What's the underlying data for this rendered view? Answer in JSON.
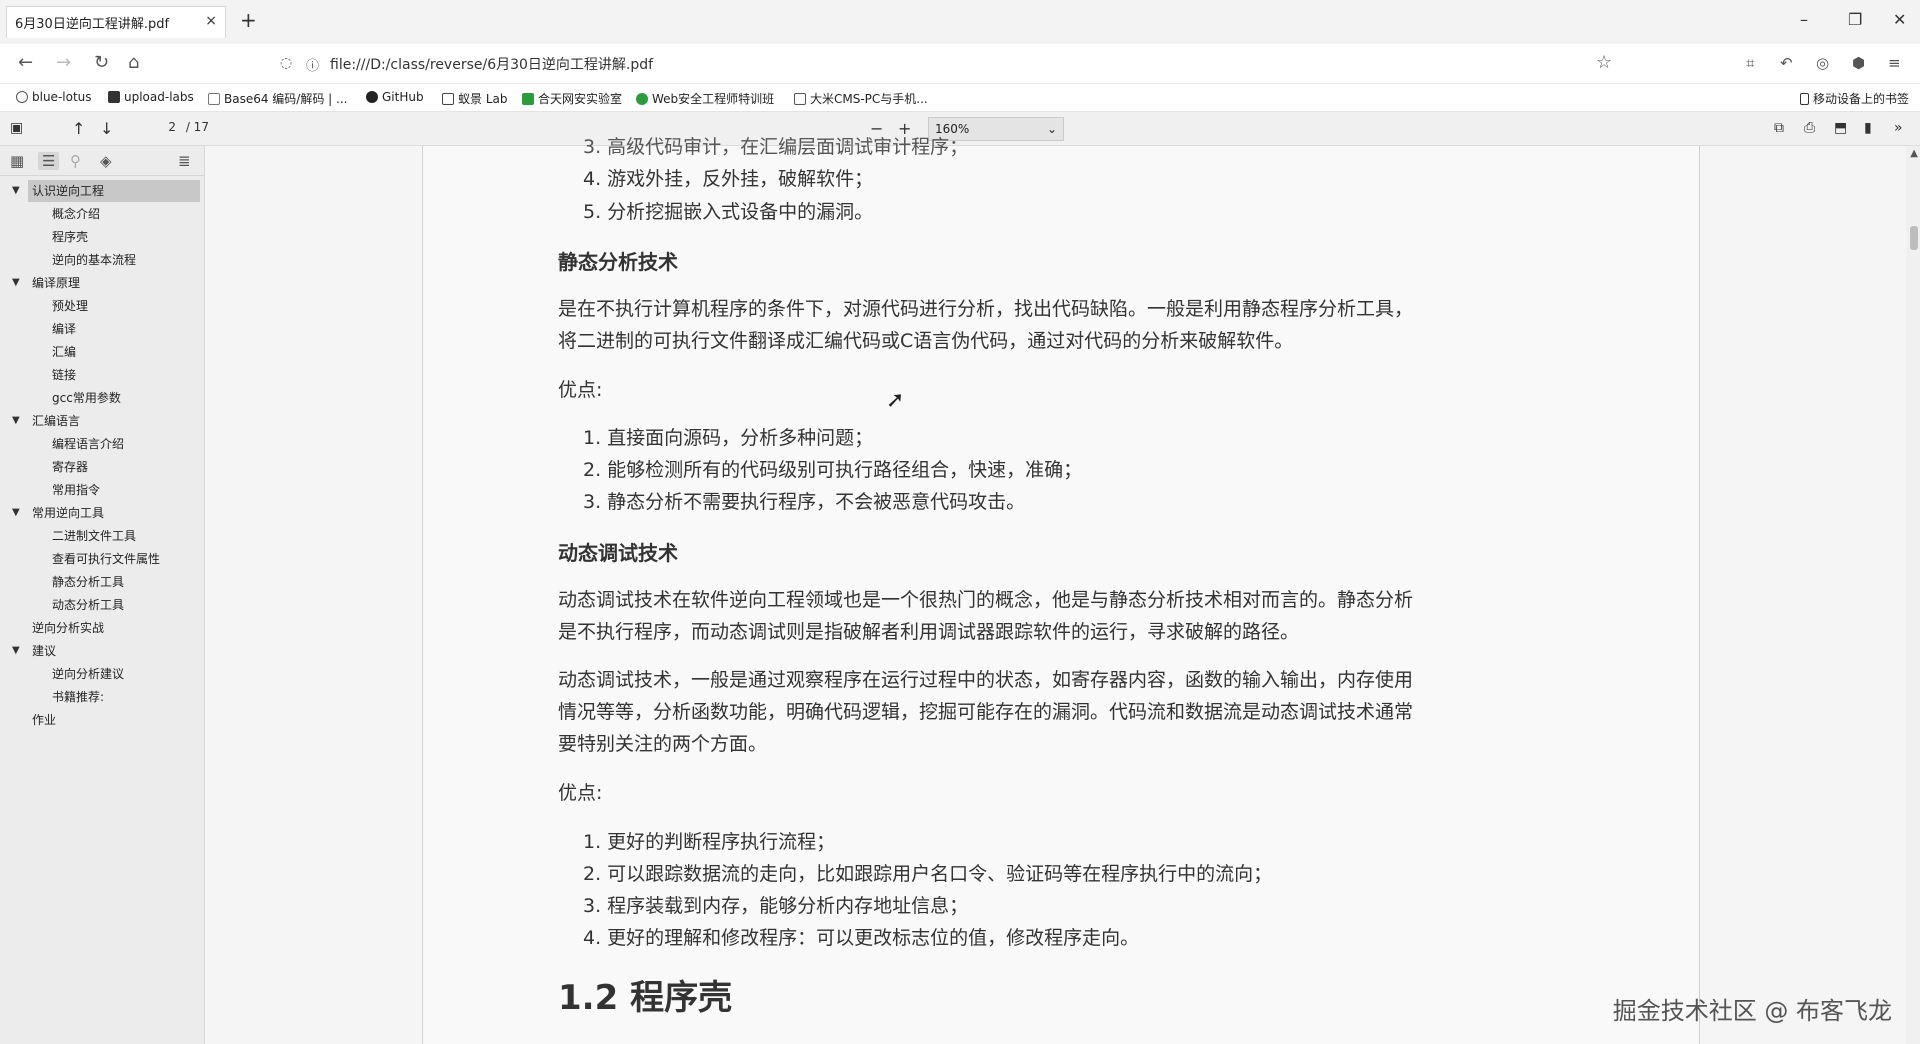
{
  "tab": {
    "title": "6月30日逆向工程讲解.pdf",
    "close": "×",
    "new": "+"
  },
  "window": {
    "minimize": "–",
    "restore": "❐",
    "close": "✕"
  },
  "nav": {
    "back": "←",
    "forward": "→",
    "reload": "↻",
    "home": "⌂",
    "url": "file:///D:/class/reverse/6月30日逆向工程讲解.pdf",
    "star": "☆"
  },
  "bookmarks": [
    {
      "label": "blue-lotus",
      "color": "#555555"
    },
    {
      "label": "upload-labs",
      "color": "#333333"
    },
    {
      "label": "Base64 编码/解码 | ...",
      "color": "#777777"
    },
    {
      "label": "GitHub",
      "color": "#222222"
    },
    {
      "label": "蚁景 Lab",
      "color": "#444444"
    },
    {
      "label": "合天网安实验室",
      "color": "#2a9d3b"
    },
    {
      "label": "Web安全工程师特训班",
      "color": "#2a9d3b"
    },
    {
      "label": "大米CMS-PC与手机...",
      "color": "#555555"
    }
  ],
  "mobile_bookmarks": "移动设备上的书签",
  "pdf": {
    "page_current": "2",
    "page_total": "/ 17",
    "zoom": "160%",
    "zoom_minus": "−",
    "zoom_plus": "+"
  },
  "outline": [
    {
      "label": "认识逆向工程",
      "level": 0,
      "expanded": true,
      "selected": true
    },
    {
      "label": "概念介绍",
      "level": 1
    },
    {
      "label": "程序壳",
      "level": 1
    },
    {
      "label": "逆向的基本流程",
      "level": 1
    },
    {
      "label": "编译原理",
      "level": 0,
      "expanded": true
    },
    {
      "label": "预处理",
      "level": 1
    },
    {
      "label": "编译",
      "level": 1
    },
    {
      "label": "汇编",
      "level": 1
    },
    {
      "label": "链接",
      "level": 1
    },
    {
      "label": "gcc常用参数",
      "level": 1
    },
    {
      "label": "汇编语言",
      "level": 0,
      "expanded": true
    },
    {
      "label": "编程语言介绍",
      "level": 1
    },
    {
      "label": "寄存器",
      "level": 1
    },
    {
      "label": "常用指令",
      "level": 1
    },
    {
      "label": "常用逆向工具",
      "level": 0,
      "expanded": true
    },
    {
      "label": "二进制文件工具",
      "level": 1
    },
    {
      "label": "查看可执行文件属性",
      "level": 1
    },
    {
      "label": "静态分析工具",
      "level": 1
    },
    {
      "label": "动态分析工具",
      "level": 1
    },
    {
      "label": "逆向分析实战",
      "level": 0
    },
    {
      "label": "建议",
      "level": 0,
      "expanded": true
    },
    {
      "label": "逆向分析建议",
      "level": 1
    },
    {
      "label": "书籍推荐:",
      "level": 1
    },
    {
      "label": "作业",
      "level": 0
    }
  ],
  "content": {
    "top_cut": "3. 高级代码审计，在汇编层面调试审计程序；",
    "list_a": [
      "4. 游戏外挂，反外挂，破解软件；",
      "5. 分析挖掘嵌入式设备中的漏洞。"
    ],
    "static_heading": "静态分析技术",
    "static_p1": "是在不执行计算机程序的条件下，对源代码进行分析，找出代码缺陷。一般是利用静态程序分析工具，",
    "static_p2": "将二进制的可执行文件翻译成汇编代码或C语言伪代码，通过对代码的分析来破解软件。",
    "pros_label_1": "优点:",
    "static_pros": [
      "1. 直接面向源码，分析多种问题；",
      "2. 能够检测所有的代码级别可执行路径组合，快速，准确；",
      "3. 静态分析不需要执行程序，不会被恶意代码攻击。"
    ],
    "dynamic_heading": "动态调试技术",
    "dynamic_p1a": "动态调试技术在软件逆向工程领域也是一个很热门的概念，他是与静态分析技术相对而言的。静态分析",
    "dynamic_p1b": "是不执行程序，而动态调试则是指破解者利用调试器跟踪软件的运行，寻求破解的路径。",
    "dynamic_p2a": "动态调试技术，一般是通过观察程序在运行过程中的状态，如寄存器内容，函数的输入输出，内存使用",
    "dynamic_p2b": "情况等等，分析函数功能，明确代码逻辑，挖掘可能存在的漏洞。代码流和数据流是动态调试技术通常",
    "dynamic_p2c": "要特别关注的两个方面。",
    "pros_label_2": "优点:",
    "dynamic_pros": [
      "1. 更好的判断程序执行流程；",
      "2. 可以跟踪数据流的走向，比如跟踪用户名口令、验证码等在程序执行中的流向；",
      "3. 程序装载到内存，能够分析内存地址信息；",
      "4. 更好的理解和修改程序：可以更改标志位的值，修改程序走向。"
    ],
    "section_heading": "1.2 程序壳"
  },
  "watermark": "掘金技术社区 @ 布客飞龙"
}
